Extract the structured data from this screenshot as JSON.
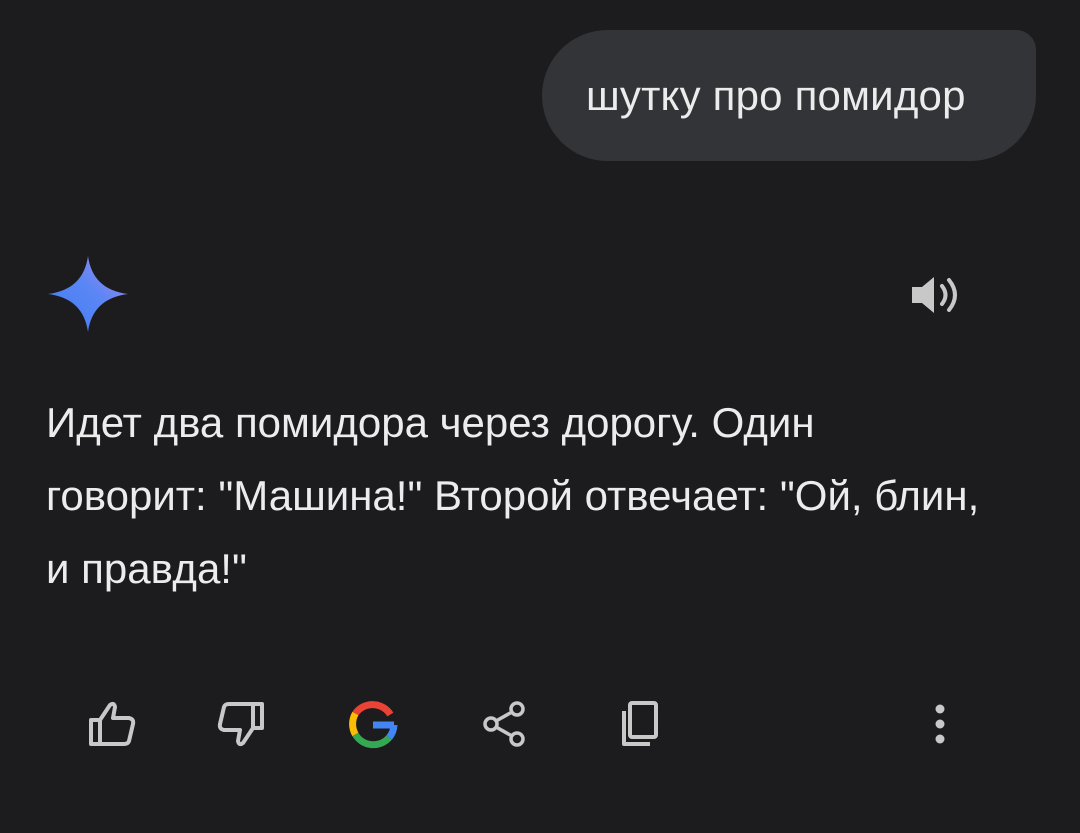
{
  "user_message": {
    "text": "шутку про помидор"
  },
  "assistant": {
    "response": "Идет два помидора через дорогу. Один говорит: \"Машина!\" Второй отвечает: \"Ой, блин, и правда!\"",
    "avatar_icon": "gemini-sparkle-icon",
    "speaker_icon": "speaker-icon"
  },
  "actions": [
    {
      "name": "thumbs-up-icon"
    },
    {
      "name": "thumbs-down-icon"
    },
    {
      "name": "google-g-icon"
    },
    {
      "name": "share-icon"
    },
    {
      "name": "copy-icon"
    },
    {
      "name": "more-vertical-icon"
    }
  ],
  "colors": {
    "background": "#1c1c1e",
    "bubble": "#333437",
    "text": "#ececec",
    "icon": "#c8c8c8"
  }
}
